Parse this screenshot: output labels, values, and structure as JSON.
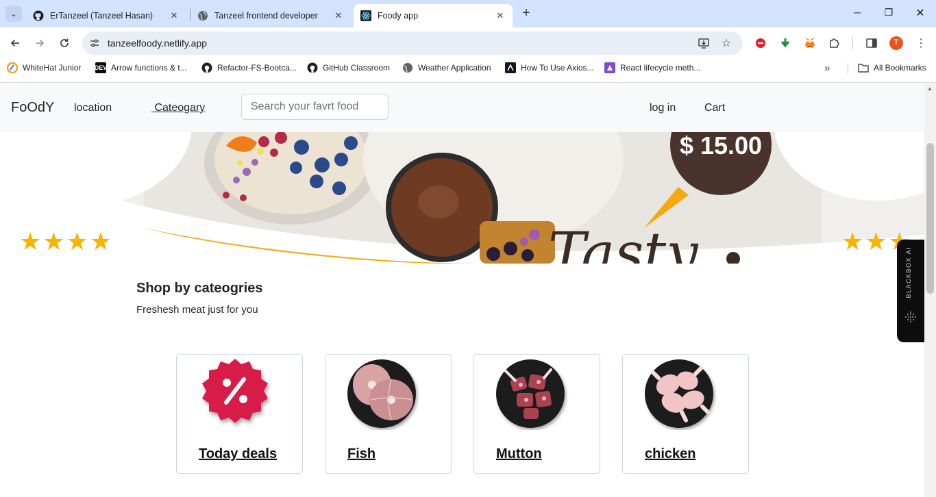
{
  "browser": {
    "tabs": [
      {
        "title": "ErTanzeel (Tanzeel Hasan)",
        "icon": "github-icon",
        "active": false
      },
      {
        "title": "Tanzeel frontend developer",
        "icon": "globe-icon",
        "active": false
      },
      {
        "title": "Foody app",
        "icon": "react-icon",
        "active": true
      }
    ],
    "url": "tanzeelfoody.netlify.app",
    "bookmarks": [
      {
        "label": "WhiteHat Junior",
        "icon": "whitehat-icon"
      },
      {
        "label": "Arrow functions & t...",
        "icon": "dev-icon"
      },
      {
        "label": "Refactor-FS-Bootca...",
        "icon": "github-icon"
      },
      {
        "label": "GitHub Classroom",
        "icon": "github-icon"
      },
      {
        "label": "Weather Application",
        "icon": "globe-icon"
      },
      {
        "label": "How To Use Axios...",
        "icon": "axios-icon"
      },
      {
        "label": "React lifecycle meth...",
        "icon": "react-lifecycle-icon"
      }
    ],
    "all_bookmarks": "All Bookmarks",
    "profile_initial": "T"
  },
  "site": {
    "brand": "FoOdY",
    "nav": {
      "location": "location",
      "category": "Cateogary",
      "login": "log in",
      "cart": "Cart"
    },
    "search_placeholder": "Search your favrt food",
    "hero": {
      "price": "$ 15.00",
      "script_text": "Tasty",
      "stars_left": "★★★★",
      "stars_right": "★★★",
      "rating_stars": 4
    },
    "section": {
      "title": "Shop by cateogries",
      "subtitle": "Freshesh meat just for you"
    },
    "categories": [
      {
        "label": "Today deals",
        "icon": "discount-badge-icon"
      },
      {
        "label": "Fish",
        "icon": "fish-steak-icon"
      },
      {
        "label": "Mutton",
        "icon": "mutton-icon"
      },
      {
        "label": "chicken",
        "icon": "chicken-icon"
      }
    ]
  },
  "widget": {
    "label": "BLACKBOX AI"
  },
  "colors": {
    "tabstrip": "#d3e3fd",
    "accent_star": "#f8b400",
    "price_circle": "#4a332d",
    "deal_badge": "#d81b4a"
  }
}
